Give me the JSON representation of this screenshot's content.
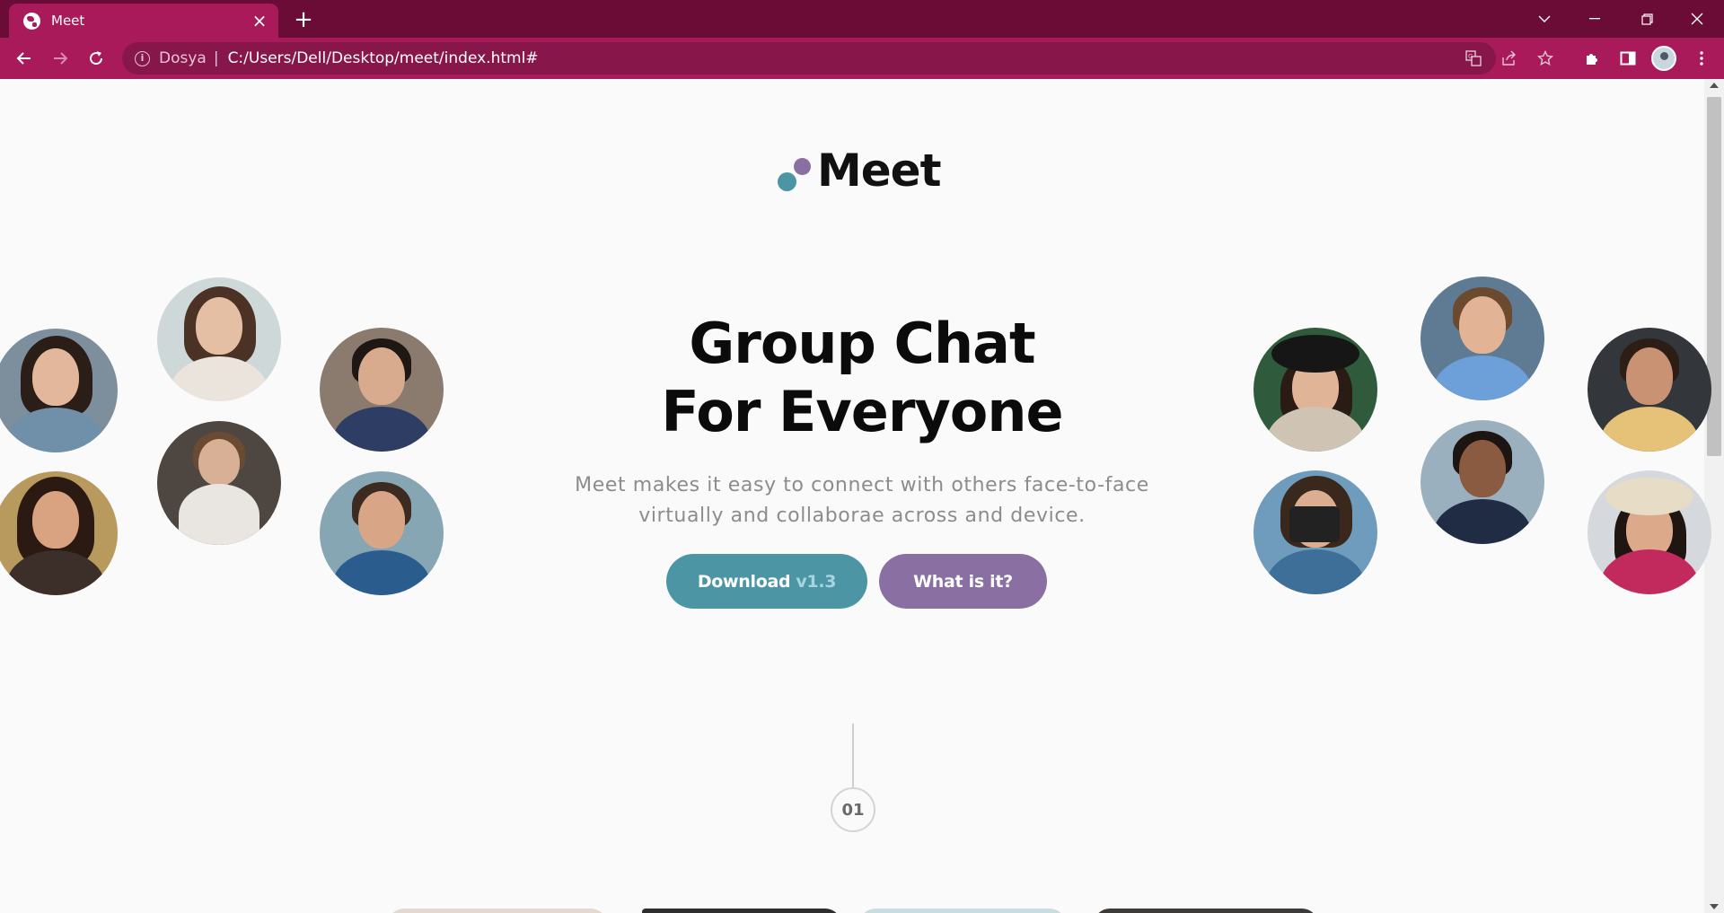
{
  "browser": {
    "tab_title": "Meet",
    "tab_close": "×",
    "new_tab": "+",
    "site_chip": "Dosya",
    "url": "C:/Users/Dell/Desktop/meet/index.html#",
    "icons": [
      "globe-icon",
      "close-icon",
      "plus-icon",
      "back-icon",
      "forward-icon",
      "reload-icon",
      "info-icon",
      "translate-icon",
      "share-icon",
      "star-icon",
      "extensions-icon",
      "side-panel-icon",
      "profile-avatar",
      "menu-icon",
      "chevron-down-icon",
      "minimize-icon",
      "restore-icon",
      "window-close-icon"
    ],
    "theme": {
      "tabbar": "#6a0c36",
      "toolbar": "#a91a5b",
      "omnibox": "#87164a"
    }
  },
  "page": {
    "logo": "Meet",
    "hero_title_line1": "Group Chat",
    "hero_title_line2": "For Everyone",
    "hero_subtitle_line1": "Meet makes it easy to connect with others face-to-face",
    "hero_subtitle_line2": "virtually and collaborae across and device.",
    "download_label": "Download",
    "download_version": "v1.3",
    "what_label": "What is it?",
    "step_number": "01",
    "colors": {
      "teal": "#4b95a5",
      "purple": "#8a6fa2",
      "text": "#0b0b0b",
      "muted": "#8c8c8c"
    }
  },
  "avatars": [
    {
      "name": "avatar-woman-glasses"
    },
    {
      "name": "avatar-woman-smiling-sunset"
    },
    {
      "name": "avatar-woman-hands-on-chin"
    },
    {
      "name": "avatar-woman-sitting-deck"
    },
    {
      "name": "avatar-man-smiling"
    },
    {
      "name": "avatar-man-reading-tablet"
    },
    {
      "name": "avatar-woman-black-hat"
    },
    {
      "name": "avatar-woman-camera"
    },
    {
      "name": "avatar-man-laptop"
    },
    {
      "name": "avatar-man-suit"
    },
    {
      "name": "avatar-man-glasses-curly"
    },
    {
      "name": "avatar-woman-straw-hat"
    }
  ]
}
